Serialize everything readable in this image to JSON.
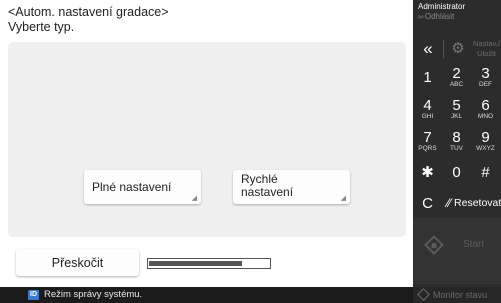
{
  "header": {
    "title": "<Autom. nastavení gradace>",
    "subtitle": "Vyberte typ."
  },
  "options": [
    {
      "label": "Plné nastavení"
    },
    {
      "label_line1": "Rychlé",
      "label_line2": "nastavení"
    }
  ],
  "footer": {
    "skip_label": "Přeskočit",
    "progress_percent": 78
  },
  "status_bar": {
    "icon_label": "ID",
    "text": "Režim správy systému."
  },
  "side_panel": {
    "user": "Administrator",
    "logout": "Odhlásit",
    "collapse_icon": "«",
    "settings_line1": "Nastav./",
    "settings_line2": "Uložit",
    "keypad": [
      {
        "main": "1",
        "sub": ""
      },
      {
        "main": "2",
        "sub": "ABC"
      },
      {
        "main": "3",
        "sub": "DEF"
      },
      {
        "main": "4",
        "sub": "GHI"
      },
      {
        "main": "5",
        "sub": "JKL"
      },
      {
        "main": "6",
        "sub": "MNO"
      },
      {
        "main": "7",
        "sub": "PQRS"
      },
      {
        "main": "8",
        "sub": "TUV"
      },
      {
        "main": "9",
        "sub": "WXYZ"
      },
      {
        "main": "✱",
        "sub": ""
      },
      {
        "main": "0",
        "sub": ""
      },
      {
        "main": "#",
        "sub": ""
      }
    ],
    "clear_label": "C",
    "reset_label": "Resetovat",
    "start_label": "Start",
    "monitor_label": "Monitor stavu"
  },
  "colors": {
    "side_bg": "#2c2c2c",
    "status_bg": "#1b1b1b",
    "panel_bg": "#efefef",
    "id_badge": "#3a78c8"
  }
}
